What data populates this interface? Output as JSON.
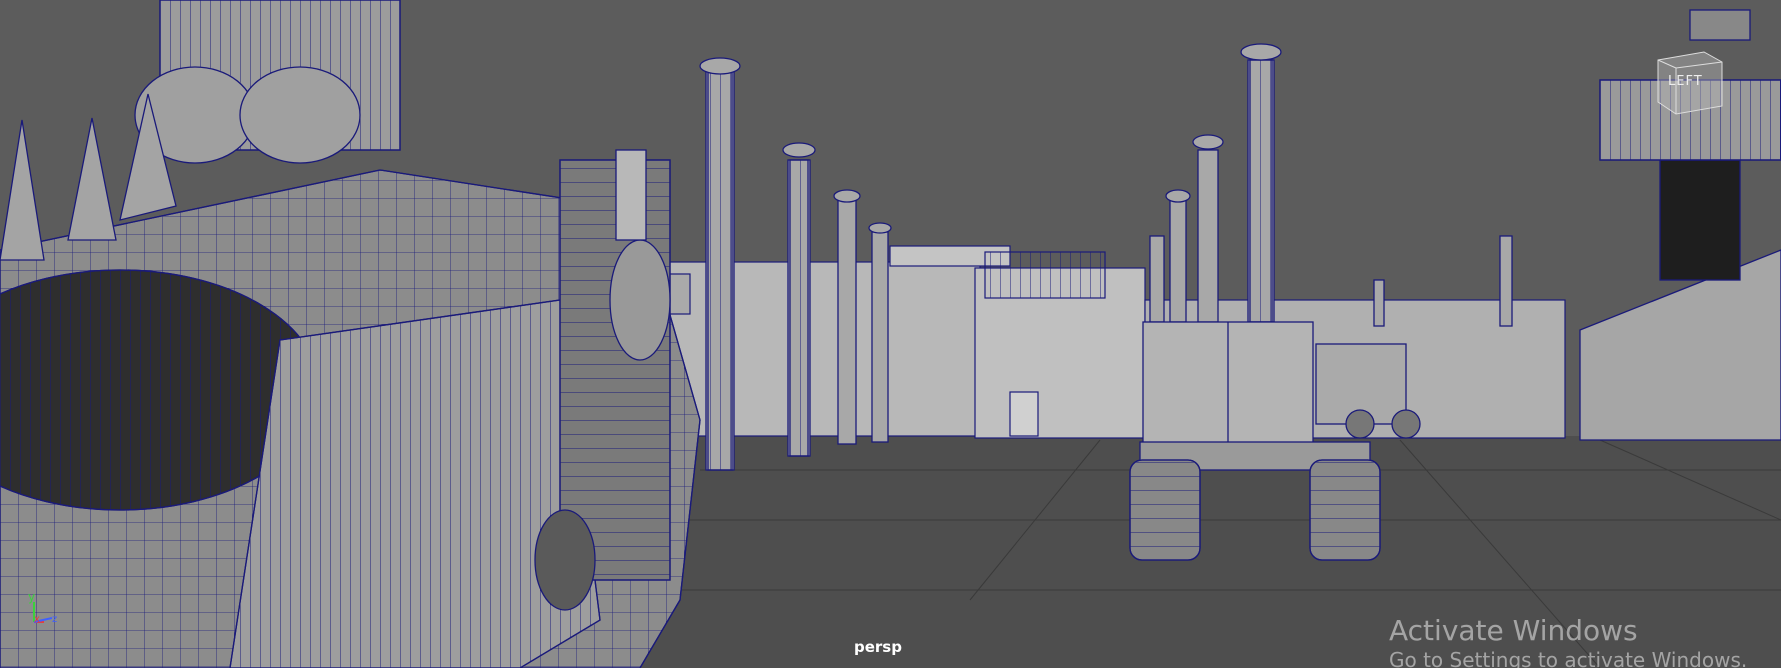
{
  "viewport": {
    "camera_label": "persp",
    "view_cube_label": "LEFT",
    "axis": {
      "y": "y",
      "x": "x",
      "z": "z"
    }
  },
  "watermark": {
    "title": "Activate Windows",
    "subtitle": "Go to Settings to activate Windows."
  },
  "colors": {
    "background": "#5c5c5c",
    "wireframe": "#1a1a7a",
    "surface_light": "#b4b4b4",
    "surface_mid": "#8a8a8a",
    "surface_dark": "#3a3a3a"
  }
}
